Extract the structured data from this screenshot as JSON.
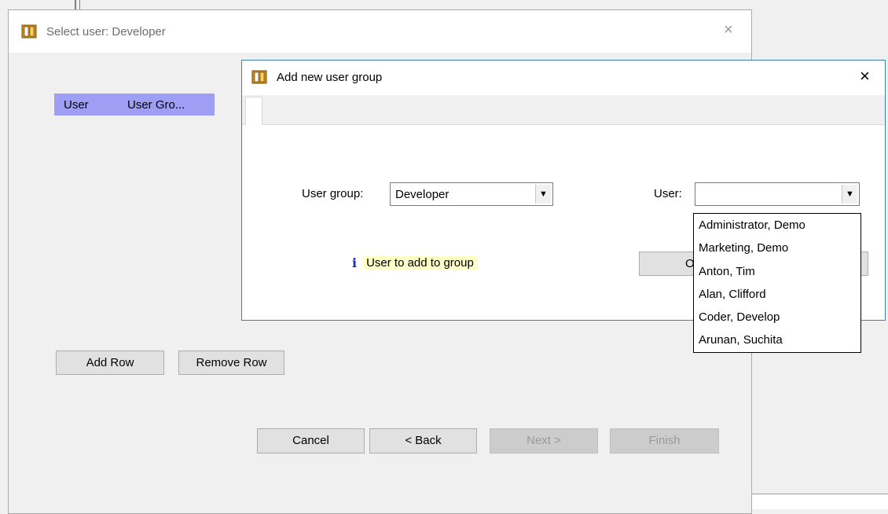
{
  "wizard": {
    "title": "Select user: Developer",
    "close_glyph": "×",
    "table_columns": [
      "User",
      "User Gro..."
    ],
    "add_row_label": "Add Row",
    "remove_row_label": "Remove Row",
    "cancel_label": "Cancel",
    "back_label": "< Back",
    "next_label": "Next >",
    "finish_label": "Finish"
  },
  "dialog": {
    "title": "Add new user group",
    "close_glyph": "×",
    "user_group_label": "User group:",
    "user_group_value": "Developer",
    "user_label": "User:",
    "user_value": "",
    "hint_icon": "info-icon",
    "hint_icon_glyph": "i",
    "hint_text": "User to add to group",
    "ok_partial": "O",
    "user_options": [
      "Administrator, Demo",
      "Marketing, Demo",
      "Anton, Tim",
      "Alan, Clifford",
      "Coder, Develop",
      "Arunan, Suchita"
    ]
  },
  "colors": {
    "header_highlight": "#9e9ef5",
    "hint_background": "#ffffc8",
    "dialog_border": "#3c7fb1",
    "info_icon": "#1a2ca8"
  }
}
